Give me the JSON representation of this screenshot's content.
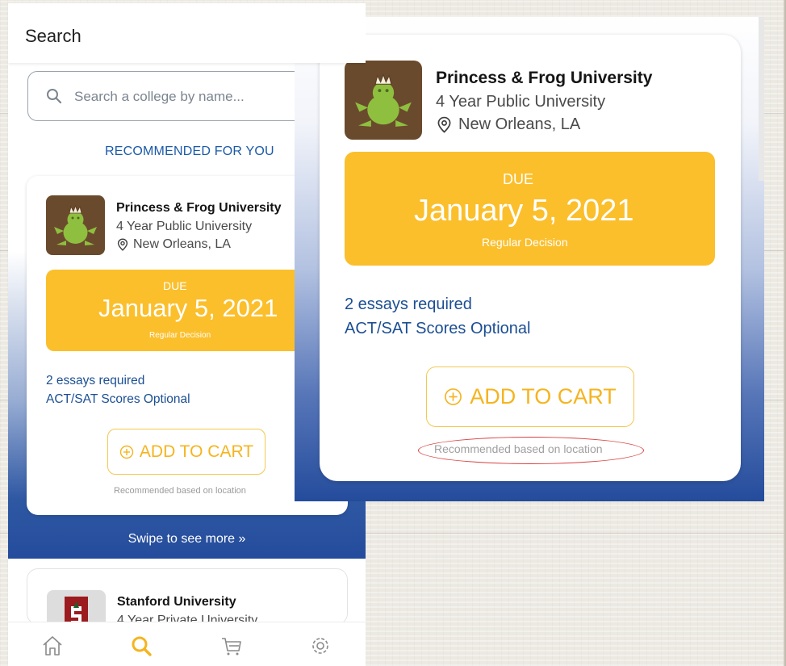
{
  "phone": {
    "header_title": "Search",
    "search_placeholder": "Search a college by name...",
    "recommended_label": "RECOMMENDED FOR YOU",
    "featured_college": {
      "name": "Princess & Frog University",
      "type": "4 Year Public University",
      "location": "New Orleans, LA",
      "due_label": "DUE",
      "due_date": "January 5, 2021",
      "decision_type": "Regular Decision",
      "essays": "2 essays required",
      "scores": "ACT/SAT Scores Optional",
      "add_to_cart_label": "ADD TO CART",
      "recommendation_reason": "Recommended based on location"
    },
    "swipe_hint": "Swipe to see more »",
    "next_college": {
      "name": "Stanford University",
      "type": "4 Year Private University"
    },
    "bottom_nav": [
      {
        "icon": "home-icon",
        "active": false
      },
      {
        "icon": "search-icon",
        "active": true
      },
      {
        "icon": "cart-icon",
        "active": false
      },
      {
        "icon": "gear-icon",
        "active": false
      }
    ]
  },
  "zoom_card": {
    "name": "Princess & Frog University",
    "type": "4 Year Public University",
    "location": "New Orleans, LA",
    "due_label": "DUE",
    "due_date": "January 5, 2021",
    "decision_type": "Regular Decision",
    "essays": "2 essays required",
    "scores": "ACT/SAT Scores Optional",
    "add_to_cart_label": "ADD TO CART",
    "recommendation_reason": "Recommended based on location"
  },
  "colors": {
    "accent_yellow": "#fbbf2c",
    "link_blue": "#1b4f93",
    "gradient_blue": "#244c9c",
    "frog_logo_bg": "#6a4a2d",
    "highlight_red": "#d9403f"
  }
}
